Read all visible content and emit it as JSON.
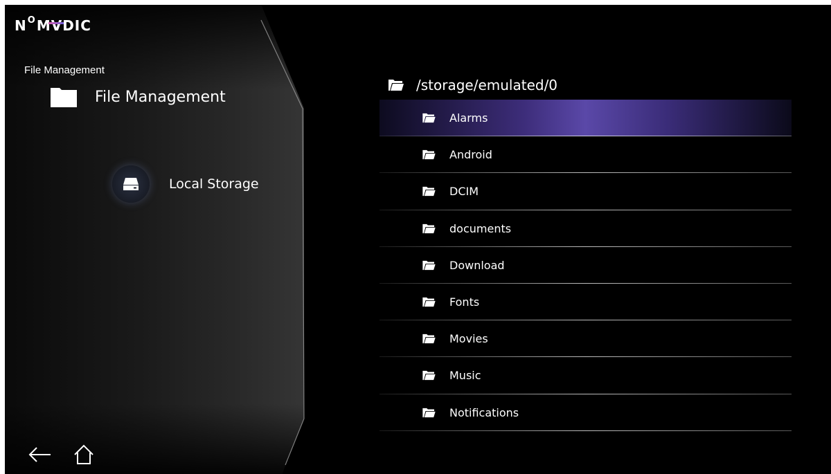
{
  "brand": {
    "logo_n": "N",
    "logo_o": "O",
    "logo_m": "M",
    "logo_v": "V",
    "logo_dic": "DIC"
  },
  "breadcrumb": "File Management",
  "section": {
    "title": "File Management",
    "icon": "folder-icon"
  },
  "storage": {
    "label": "Local Storage",
    "icon": "hard-drive-icon"
  },
  "path": {
    "text": "/storage/emulated/0",
    "icon": "folder-icon"
  },
  "files": [
    {
      "name": "Alarms",
      "selected": true
    },
    {
      "name": "Android",
      "selected": false
    },
    {
      "name": "DCIM",
      "selected": false
    },
    {
      "name": "documents",
      "selected": false
    },
    {
      "name": "Download",
      "selected": false
    },
    {
      "name": "Fonts",
      "selected": false
    },
    {
      "name": "Movies",
      "selected": false
    },
    {
      "name": "Music",
      "selected": false
    },
    {
      "name": "Notifications",
      "selected": false
    }
  ],
  "nav": {
    "back_icon": "back-arrow-icon",
    "home_icon": "home-icon"
  },
  "colors": {
    "accent": "#5a48a8",
    "background": "#000000",
    "text": "#ffffff"
  }
}
